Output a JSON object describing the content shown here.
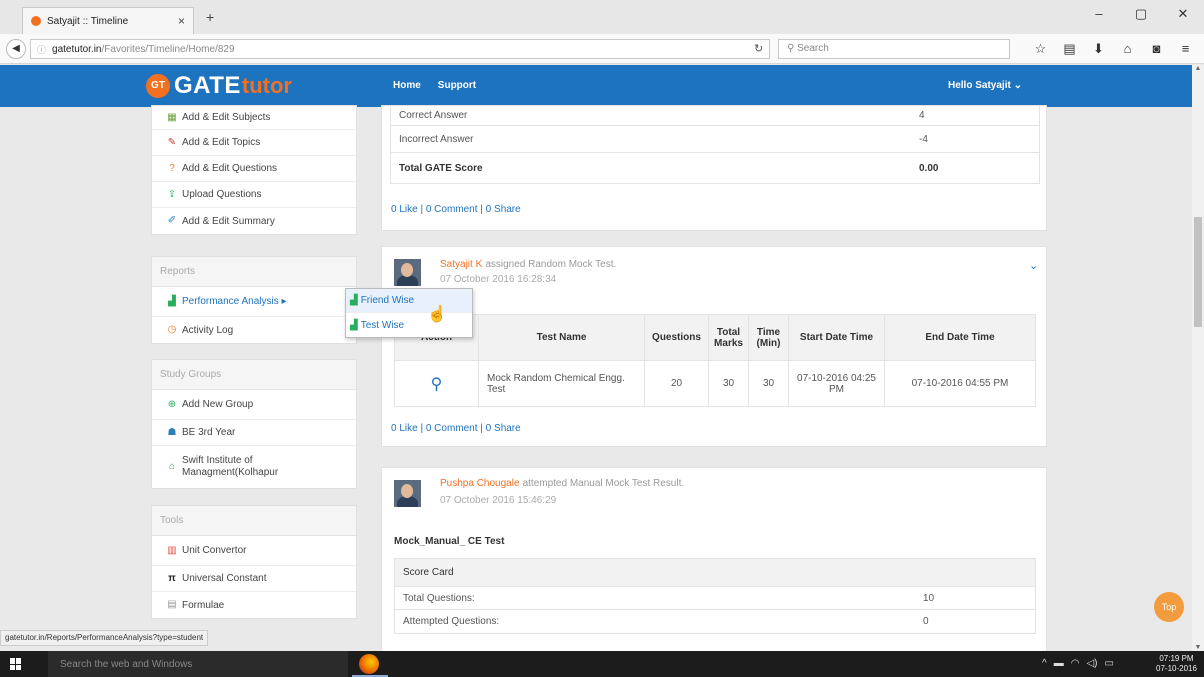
{
  "browser": {
    "tab_title": "Satyajit :: Timeline",
    "url_host": "gatetutor.in",
    "url_path": "/Favorites/Timeline/Home/829",
    "search_placeholder": "Search",
    "status_url": "gatetutor.in/Reports/PerformanceAnalysis?type=student"
  },
  "site": {
    "logo_badge": "GT",
    "logo_gate": "GATE",
    "logo_tutor": "tutor",
    "nav": [
      "Home",
      "Support"
    ],
    "greeting": "Hello Satyajit"
  },
  "sidebar": {
    "top_items": [
      {
        "label": "Add & Edit Subjects",
        "icon": "subjects-icon"
      },
      {
        "label": "Add & Edit Topics",
        "icon": "pencil-icon"
      },
      {
        "label": "Add & Edit Questions",
        "icon": "question-icon"
      },
      {
        "label": "Upload Questions",
        "icon": "upload-icon"
      },
      {
        "label": "Add & Edit Summary",
        "icon": "edit-icon"
      }
    ],
    "reports_head": "Reports",
    "reports_items": [
      {
        "label": "Performance Analysis ▸",
        "icon": "chart-icon"
      },
      {
        "label": "Activity Log",
        "icon": "clock-icon"
      }
    ],
    "groups_head": "Study Groups",
    "groups_items": [
      {
        "label": "Add New Group",
        "icon": "add-icon"
      },
      {
        "label": "BE 3rd Year",
        "icon": "group-icon"
      },
      {
        "label": "Swift Institute of Managment(Kolhapur",
        "icon": "institute-icon"
      }
    ],
    "tools_head": "Tools",
    "tools_items": [
      {
        "label": "Unit Convertor",
        "icon": "convert-icon"
      },
      {
        "label": "Universal Constant",
        "icon": "pi-icon"
      },
      {
        "label": "Formulae",
        "icon": "formula-icon"
      }
    ]
  },
  "submenu": {
    "items": [
      "Friend Wise",
      "Test Wise"
    ]
  },
  "post1": {
    "rows": [
      {
        "label": "Correct Answer",
        "value": "4"
      },
      {
        "label": "Incorrect Answer",
        "value": "-4"
      },
      {
        "label": "Total GATE Score",
        "value": "0.00"
      }
    ],
    "links": "0 Like | 0 Comment | 0 Share"
  },
  "post2": {
    "name": "Satyajit K",
    "action": "assigned Random Mock Test.",
    "date": "07 October 2016 16:28:34",
    "headers": [
      "Action",
      "Test Name",
      "Questions",
      "Total Marks",
      "Time (Min)",
      "Start Date Time",
      "End Date Time"
    ],
    "row": {
      "test_name": "Mock Random Chemical Engg. Test",
      "questions": "20",
      "total_marks": "30",
      "time": "30",
      "start": "07-10-2016 04:25 PM",
      "end": "07-10-2016 04:55 PM"
    },
    "links": "0 Like | 0 Comment | 0 Share"
  },
  "post3": {
    "name": "Pushpa Chougale",
    "action": "attempted Manual Mock Test Result.",
    "date": "07 October 2016 15:46:29",
    "test_title": "Mock_Manual_ CE Test",
    "score_card": "Score Card",
    "rows": [
      {
        "label": "Total Questions:",
        "value": "10"
      },
      {
        "label": "Attempted Questions:",
        "value": "0"
      }
    ]
  },
  "top_button": "Top",
  "taskbar": {
    "search": "Search the web and Windows",
    "time": "07:19 PM",
    "date": "07-10-2016"
  }
}
